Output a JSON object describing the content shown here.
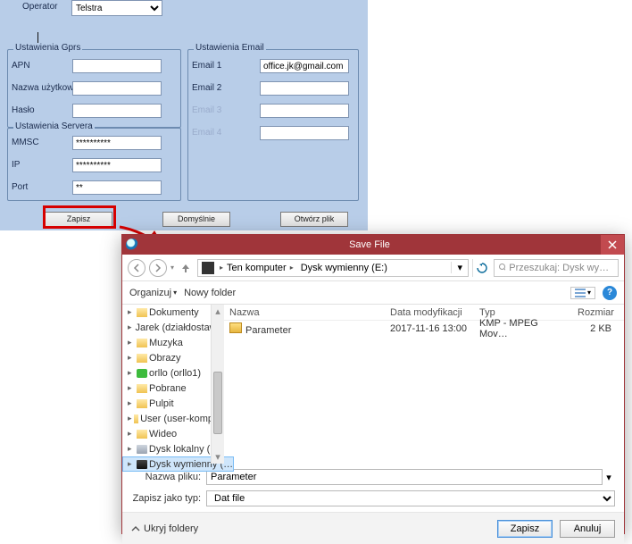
{
  "bg_app": {
    "operator_label": "Operator",
    "operator_value": "Telstra",
    "gprs": {
      "title": "Ustawienia Gprs",
      "apn_label": "APN",
      "apn_value": "",
      "user_label": "Nazwa użytkow.",
      "user_value": "",
      "pass_label": "Hasło",
      "pass_value": ""
    },
    "server": {
      "title": "Ustawienia Servera",
      "mmsc_label": "MMSC",
      "mmsc_value": "**********",
      "ip_label": "IP",
      "ip_value": "**********",
      "port_label": "Port",
      "port_value": "**"
    },
    "email": {
      "title": "Ustawienia Email",
      "e1_label": "Email 1",
      "e1_value": "office.jk@gmail.com",
      "e2_label": "Email 2",
      "e2_value": "",
      "e3_label": "Email 3",
      "e3_value": "",
      "e4_label": "Email 4",
      "e4_value": ""
    },
    "buttons": {
      "save": "Zapisz",
      "default": "Domyślnie",
      "open": "Otwórz plik"
    }
  },
  "dialog": {
    "title": "Save File",
    "breadcrumb": {
      "seg1": "Ten komputer",
      "seg2": "Dysk wymienny (E:)"
    },
    "search_placeholder": "Przeszukaj: Dysk wymienny (E:)",
    "toolbar": {
      "organize": "Organizuj",
      "new_folder": "Nowy folder"
    },
    "columns": {
      "name": "Nazwa",
      "date": "Data modyfikacji",
      "type": "Typ",
      "size": "Rozmiar"
    },
    "tree": [
      {
        "icon": "fld-yellow",
        "label": "Dokumenty"
      },
      {
        "icon": "fld-yellow",
        "label": "Jarek (działdostaw…"
      },
      {
        "icon": "fld-yellow",
        "label": "Muzyka"
      },
      {
        "icon": "fld-yellow",
        "label": "Obrazy"
      },
      {
        "icon": "fld-green",
        "label": "orllo (orllo1)"
      },
      {
        "icon": "fld-yellow",
        "label": "Pobrane"
      },
      {
        "icon": "fld-yellow",
        "label": "Pulpit"
      },
      {
        "icon": "fld-yellow",
        "label": "User (user-komp…"
      },
      {
        "icon": "fld-yellow",
        "label": "Wideo"
      },
      {
        "icon": "fld-drive",
        "label": "Dysk lokalny (C:)"
      },
      {
        "icon": "fld-drive-usb",
        "label": "Dysk wymienny (…",
        "selected": true
      }
    ],
    "files": [
      {
        "name": "Parameter",
        "date": "2017-11-16 13:00",
        "type": "KMP - MPEG Mov…",
        "size": "2 KB"
      }
    ],
    "filename_label": "Nazwa pliku:",
    "filename_value": "Parameter",
    "filetype_label": "Zapisz jako typ:",
    "filetype_value": "Dat file",
    "hide_folders": "Ukryj foldery",
    "btn_save": "Zapisz",
    "btn_cancel": "Anuluj"
  }
}
